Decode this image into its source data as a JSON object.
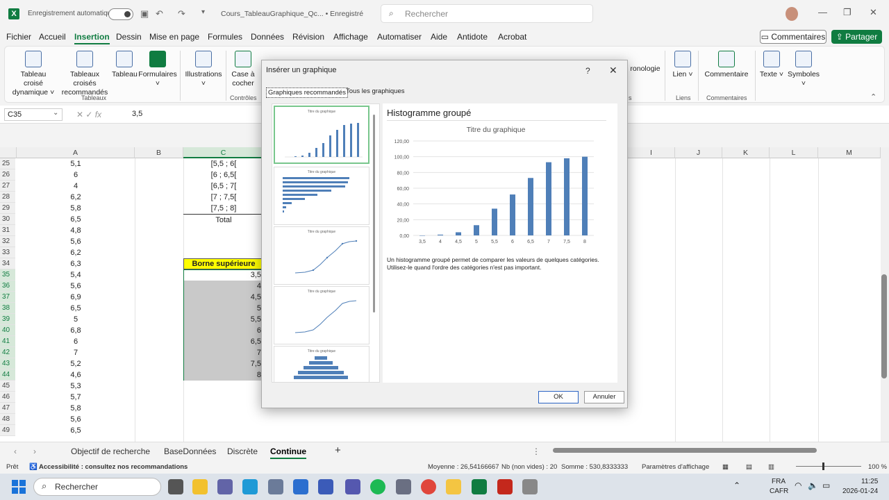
{
  "titlebar": {
    "autosave_label": "Enregistrement automatique",
    "filename": "Cours_TableauGraphique_Qc... • Enregistré",
    "search_placeholder": "Rechercher"
  },
  "menu": {
    "items": [
      "Fichier",
      "Accueil",
      "Insertion",
      "Dessin",
      "Mise en page",
      "Formules",
      "Données",
      "Révision",
      "Affichage",
      "Automatiser",
      "Aide",
      "Antidote",
      "Acrobat"
    ],
    "active": "Insertion",
    "comments_label": "Commentaires",
    "share_label": "Partager"
  },
  "ribbon": {
    "buttons": [
      {
        "label": "Tableau croisé dynamique ˅"
      },
      {
        "label": "Tableaux croisés recommandés"
      },
      {
        "label": "Tableau"
      },
      {
        "label": "Formulaires ˅"
      },
      {
        "label": "Illustrations ˅"
      },
      {
        "label": "Case à cocher"
      },
      {
        "label": "ronologie"
      },
      {
        "label": "Lien ˅"
      },
      {
        "label": "Commentaire"
      },
      {
        "label": "Texte ˅"
      },
      {
        "label": "Symboles ˅"
      }
    ],
    "groups": {
      "tableaux": "Tableaux",
      "controles": "Contrôles",
      "s": "s",
      "liens": "Liens",
      "commentaires": "Commentaires"
    }
  },
  "formula": {
    "namebox": "C35",
    "value": "3,5"
  },
  "grid": {
    "columns": [
      {
        "label": "A"
      },
      {
        "label": "B"
      },
      {
        "label": "C"
      },
      {
        "label": "I"
      },
      {
        "label": "J"
      },
      {
        "label": "K"
      },
      {
        "label": "L"
      },
      {
        "label": "M"
      }
    ],
    "rows": [
      "25",
      "26",
      "27",
      "28",
      "29",
      "30",
      "31",
      "32",
      "33",
      "34",
      "35",
      "36",
      "37",
      "38",
      "39",
      "40",
      "41",
      "42",
      "43",
      "44",
      "45",
      "46",
      "47",
      "48",
      "49"
    ],
    "colA": [
      "5,1",
      "6",
      "4",
      "6,2",
      "5,8",
      "6,5",
      "4,8",
      "5,6",
      "6,2",
      "6,3",
      "5,4",
      "5,6",
      "6,9",
      "6,5",
      "5",
      "6,8",
      "6",
      "7",
      "5,2",
      "4,6",
      "5,3",
      "5,7",
      "5,8",
      "5,6",
      "6,5"
    ],
    "colC_top": [
      "[5,5 ; 6[",
      "[6 ; 6,5[",
      "[6,5 ; 7[",
      "[7 ; 7,5[",
      "[7,5 ; 8]",
      "Total"
    ],
    "yellow_header": "Borne supérieure",
    "colC_bounds": [
      "3,5",
      "4",
      "4,5",
      "5",
      "5,5",
      "6",
      "6,5",
      "7",
      "7,5",
      "8"
    ]
  },
  "sheets": {
    "tabs": [
      "Objectif de recherche",
      "BaseDonnées",
      "Discrète",
      "Continue"
    ],
    "active": "Continue",
    "add": "+"
  },
  "status": {
    "ready": "Prêt",
    "accessibility": "Accessibilité : consultez nos recommandations",
    "average": "Moyenne : 26,54166667",
    "count": "Nb (non vides) : 20",
    "sum": "Somme : 530,8333333",
    "display_settings": "Paramètres d'affichage",
    "zoom": "100 %"
  },
  "taskbar": {
    "search_placeholder": "Rechercher",
    "lang": "FRA",
    "layout": "CAFR",
    "time": "11:25",
    "date": "2026-01-24"
  },
  "dialog": {
    "title": "Insérer un graphique",
    "help": "?",
    "close": "✕",
    "tab_recommended": "Graphiques recommandés",
    "tab_all": "Tous les graphiques",
    "thumb_title": "Titre du graphique",
    "preview_heading": "Histogramme groupé",
    "description_line1": "Un histogramme groupé permet de comparer les valeurs de quelques catégories.",
    "description_line2": "Utilisez-le quand l'ordre des catégories n'est pas important.",
    "ok": "OK",
    "cancel": "Annuler"
  },
  "chart_data": {
    "type": "bar",
    "title": "Titre du graphique",
    "categories": [
      "3,5",
      "4",
      "4,5",
      "5",
      "5,5",
      "6",
      "6,5",
      "7",
      "7,5",
      "8"
    ],
    "values": [
      0,
      1,
      4,
      13,
      34,
      52,
      73,
      93,
      98,
      100
    ],
    "y_ticks": [
      "0,00",
      "20,00",
      "40,00",
      "60,00",
      "80,00",
      "100,00",
      "120,00"
    ],
    "ylim": [
      0,
      120
    ],
    "grid": true,
    "bar_color": "#4f7fb8"
  },
  "colors": {
    "excel_green": "#107c41",
    "yellow": "#ffff00",
    "selection_grey": "#c9c9c9"
  }
}
